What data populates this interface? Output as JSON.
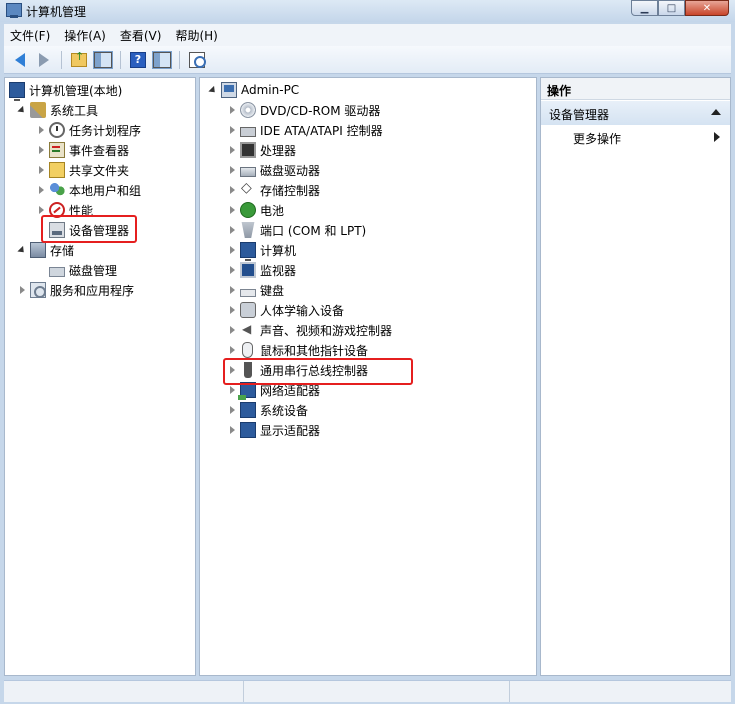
{
  "window": {
    "title": "计算机管理"
  },
  "menu": [
    "文件(F)",
    "操作(A)",
    "查看(V)",
    "帮助(H)"
  ],
  "toolbar": [
    "back-arrow",
    "forward-arrow",
    "up-folder",
    "show-hide-tree",
    "help",
    "show-hide-action-pane",
    "properties"
  ],
  "left_tree": {
    "root": "计算机管理(本地)",
    "system_tools": "系统工具",
    "task_scheduler": "任务计划程序",
    "event_viewer": "事件查看器",
    "shared_folders": "共享文件夹",
    "local_users": "本地用户和组",
    "performance": "性能",
    "device_manager": "设备管理器",
    "storage": "存储",
    "disk_management": "磁盘管理",
    "services": "服务和应用程序"
  },
  "device_tree": {
    "computer": "Admin-PC",
    "categories": [
      "DVD/CD-ROM 驱动器",
      "IDE ATA/ATAPI 控制器",
      "处理器",
      "磁盘驱动器",
      "存储控制器",
      "电池",
      "端口 (COM 和 LPT)",
      "计算机",
      "监视器",
      "键盘",
      "人体学输入设备",
      "声音、视频和游戏控制器",
      "鼠标和其他指针设备",
      "通用串行总线控制器",
      "网络适配器",
      "系统设备",
      "显示适配器"
    ]
  },
  "actions": {
    "header": "操作",
    "section": "设备管理器",
    "more": "更多操作"
  },
  "colors": {
    "highlight": "#e51f1f"
  }
}
